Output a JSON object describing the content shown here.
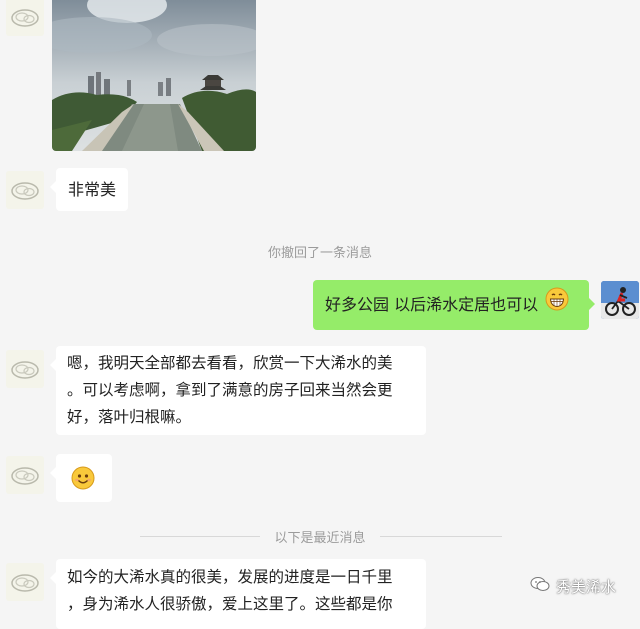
{
  "messages": {
    "m1_text": "非常美",
    "system_recalled": "你撤回了一条消息",
    "m2_text": "好多公园 以后浠水定居也可以",
    "m3_line1": "嗯，我明天全部都去看看，欣赏一下大浠水的美",
    "m3_line2": "。可以考虑啊，拿到了满意的房子回来当然会更",
    "m3_line3": "好，落叶归根嘛。",
    "system_recent": "以下是最近消息",
    "m5_line1": "如今的大浠水真的很美，发展的进度是一日千里",
    "m5_line2": "，身为浠水人很骄傲，爱上这里了。这些都是你"
  },
  "watermark": "秀美浠水",
  "icons": {
    "contact_avatar": "cloud-logo-avatar",
    "self_avatar": "cyclist-avatar",
    "grin_emoji": "grinning-face-emoji",
    "smile_emoji": "smiling-face-emoji",
    "watermark_icon": "wechat-account-icon"
  },
  "colors": {
    "background": "#f5f5f5",
    "incoming_bubble": "#ffffff",
    "outgoing_bubble": "#95ec69",
    "system_text": "#9b9b9b"
  }
}
